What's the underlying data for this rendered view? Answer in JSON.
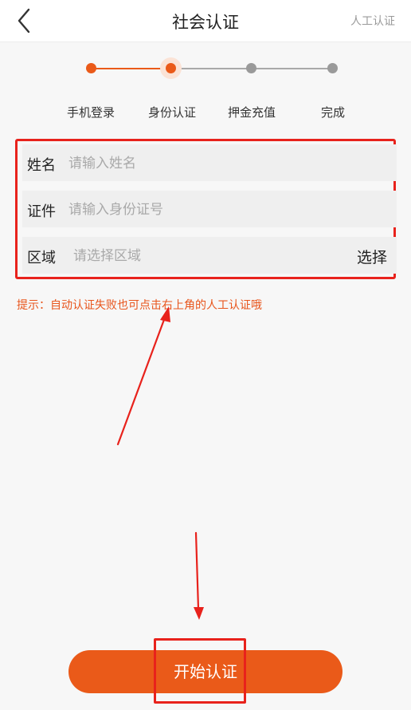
{
  "header": {
    "title": "社会认证",
    "manual_link": "人工认证"
  },
  "steps": [
    {
      "label": "手机登录",
      "state": "done"
    },
    {
      "label": "身份认证",
      "state": "current"
    },
    {
      "label": "押金充值",
      "state": "pending"
    },
    {
      "label": "完成",
      "state": "pending"
    }
  ],
  "form": {
    "name": {
      "label": "姓名",
      "placeholder": "请输入姓名"
    },
    "id": {
      "label": "证件",
      "placeholder": "请输入身份证号"
    },
    "region": {
      "label": "区域",
      "placeholder": "请选择区域",
      "select_label": "选择"
    }
  },
  "hint": "提示：自动认证失败也可点击右上角的人工认证哦",
  "start_button": "开始认证",
  "colors": {
    "accent": "#ea5a19",
    "annotation_red": "#e8221c",
    "inactive": "#9a9a9a"
  }
}
